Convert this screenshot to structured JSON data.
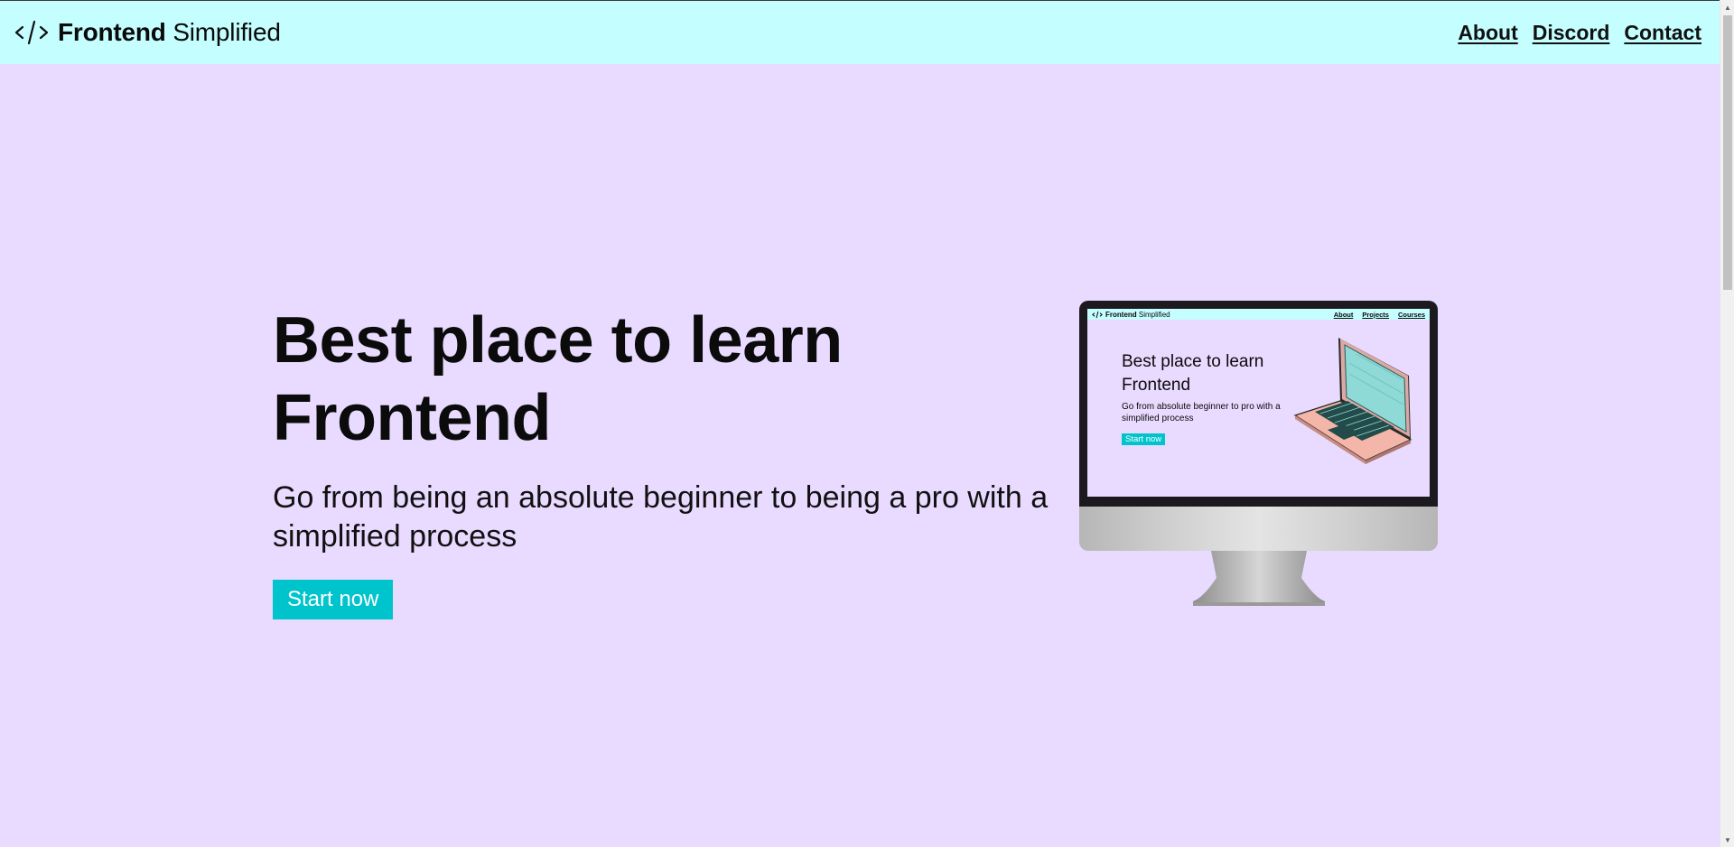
{
  "nav": {
    "logo_strong": "Frontend",
    "logo_light": "Simplified",
    "links": [
      "About",
      "Discord",
      "Contact"
    ]
  },
  "hero": {
    "title_line1": "Best place to learn",
    "title_line2": "Frontend",
    "subtitle": "Go from being an absolute beginner to being a pro with a simplified process",
    "cta": "Start now"
  },
  "monitor_screen": {
    "logo_strong": "Frontend",
    "logo_light": "Simplified",
    "links": [
      "About",
      "Projects",
      "Courses"
    ],
    "title_line1": "Best place to learn",
    "title_line2": "Frontend",
    "subtitle": "Go from absolute beginner to pro with a simplified process",
    "cta": "Start now"
  },
  "colors": {
    "page_bg": "#e9daff",
    "nav_bg": "#c5feff",
    "accent": "#00c4cc"
  },
  "icons": {
    "logo": "code-brackets-icon",
    "illustration": "laptop-icon"
  }
}
